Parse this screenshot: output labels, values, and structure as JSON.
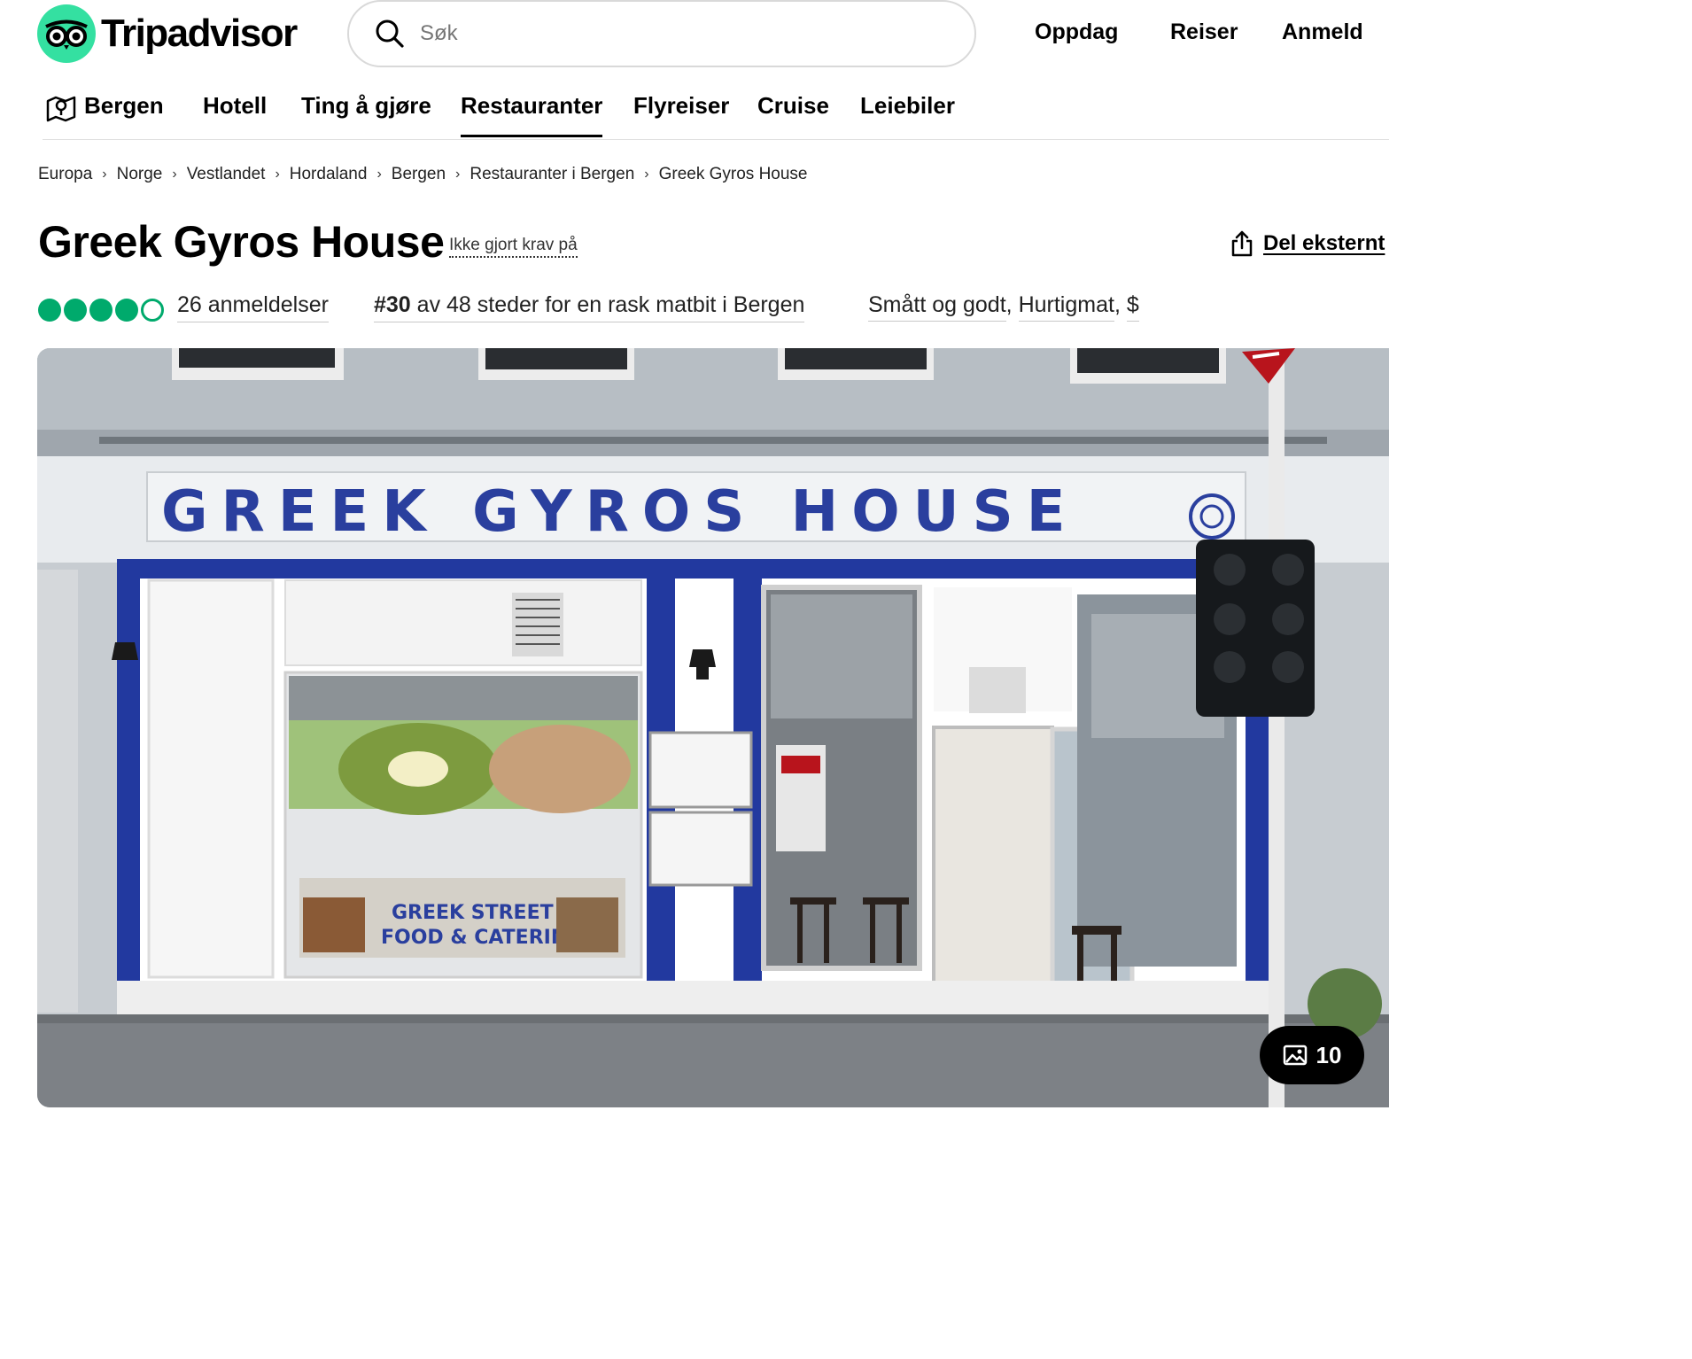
{
  "header": {
    "logo_text": "Tripadvisor",
    "search_placeholder": "Søk",
    "nav": [
      "Oppdag",
      "Reiser",
      "Anmeld"
    ]
  },
  "subnav": {
    "location": "Bergen",
    "items": [
      "Hotell",
      "Ting å gjøre",
      "Restauranter",
      "Flyreiser",
      "Cruise",
      "Leiebiler"
    ],
    "active": "Restauranter"
  },
  "breadcrumb": [
    "Europa",
    "Norge",
    "Vestlandet",
    "Hordaland",
    "Bergen",
    "Restauranter i Bergen",
    "Greek Gyros House"
  ],
  "restaurant": {
    "name": "Greek Gyros House",
    "claim_label": "Ikke gjort krav på",
    "share_label": "Del eksternt",
    "rating": 4,
    "rating_max": 5,
    "reviews": "26 anmeldelser",
    "rank": "#30",
    "rank_text": " av 48 steder for en rask matbit i Bergen",
    "cuisines": [
      "Smått og godt",
      "Hurtigmat",
      "$"
    ]
  },
  "photo": {
    "sign_text": "GREEK GYROS HOUSE",
    "window_text_1": "GREEK STREET",
    "window_text_2": "FOOD & CATERING",
    "count": "10"
  },
  "colors": {
    "brand_green": "#34e0a1",
    "rating_green": "#00aa6c",
    "sign_blue": "#2a3f9e"
  }
}
